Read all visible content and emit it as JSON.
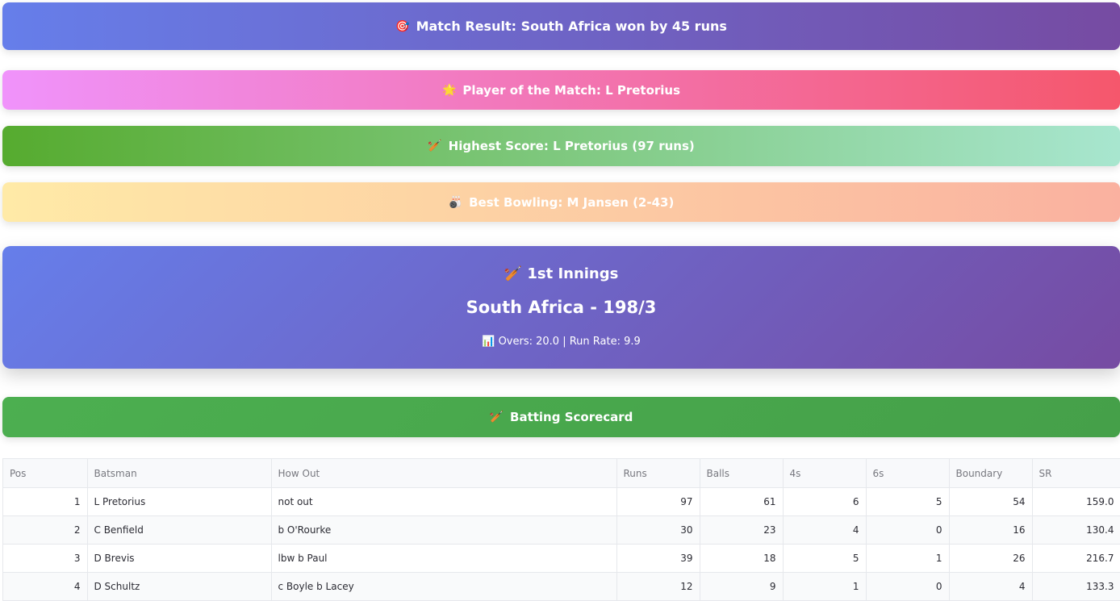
{
  "result": {
    "icon": "🎯",
    "text": "Match Result: South Africa won by 45 runs"
  },
  "player_of_match": {
    "icon": "🌟",
    "text": "Player of the Match: L Pretorius"
  },
  "highest_score": {
    "icon": "🏏",
    "text": "Highest Score: L Pretorius (97 runs)"
  },
  "best_bowling": {
    "icon": "🎳",
    "text": "Best Bowling: M Jansen (2-43)"
  },
  "innings": {
    "icon": "🏏",
    "label": "1st Innings",
    "score": "South Africa - 198/3",
    "stats_icon": "📊",
    "stats": "Overs: 20.0 | Run Rate: 9.9"
  },
  "batting": {
    "icon": "🏏",
    "title": "Batting Scorecard"
  },
  "table": {
    "headers": [
      "Pos",
      "Batsman",
      "How Out",
      "Runs",
      "Balls",
      "4s",
      "6s",
      "Boundary",
      "SR"
    ],
    "rows": [
      [
        "1",
        "L Pretorius",
        "not out",
        "97",
        "61",
        "6",
        "5",
        "54",
        "159.0"
      ],
      [
        "2",
        "C Benfield",
        "b O'Rourke",
        "30",
        "23",
        "4",
        "0",
        "16",
        "130.4"
      ],
      [
        "3",
        "D Brevis",
        "lbw b Paul",
        "39",
        "18",
        "5",
        "1",
        "26",
        "216.7"
      ],
      [
        "4",
        "D Schultz",
        "c Boyle b Lacey",
        "12",
        "9",
        "1",
        "0",
        "4",
        "133.3"
      ]
    ]
  }
}
